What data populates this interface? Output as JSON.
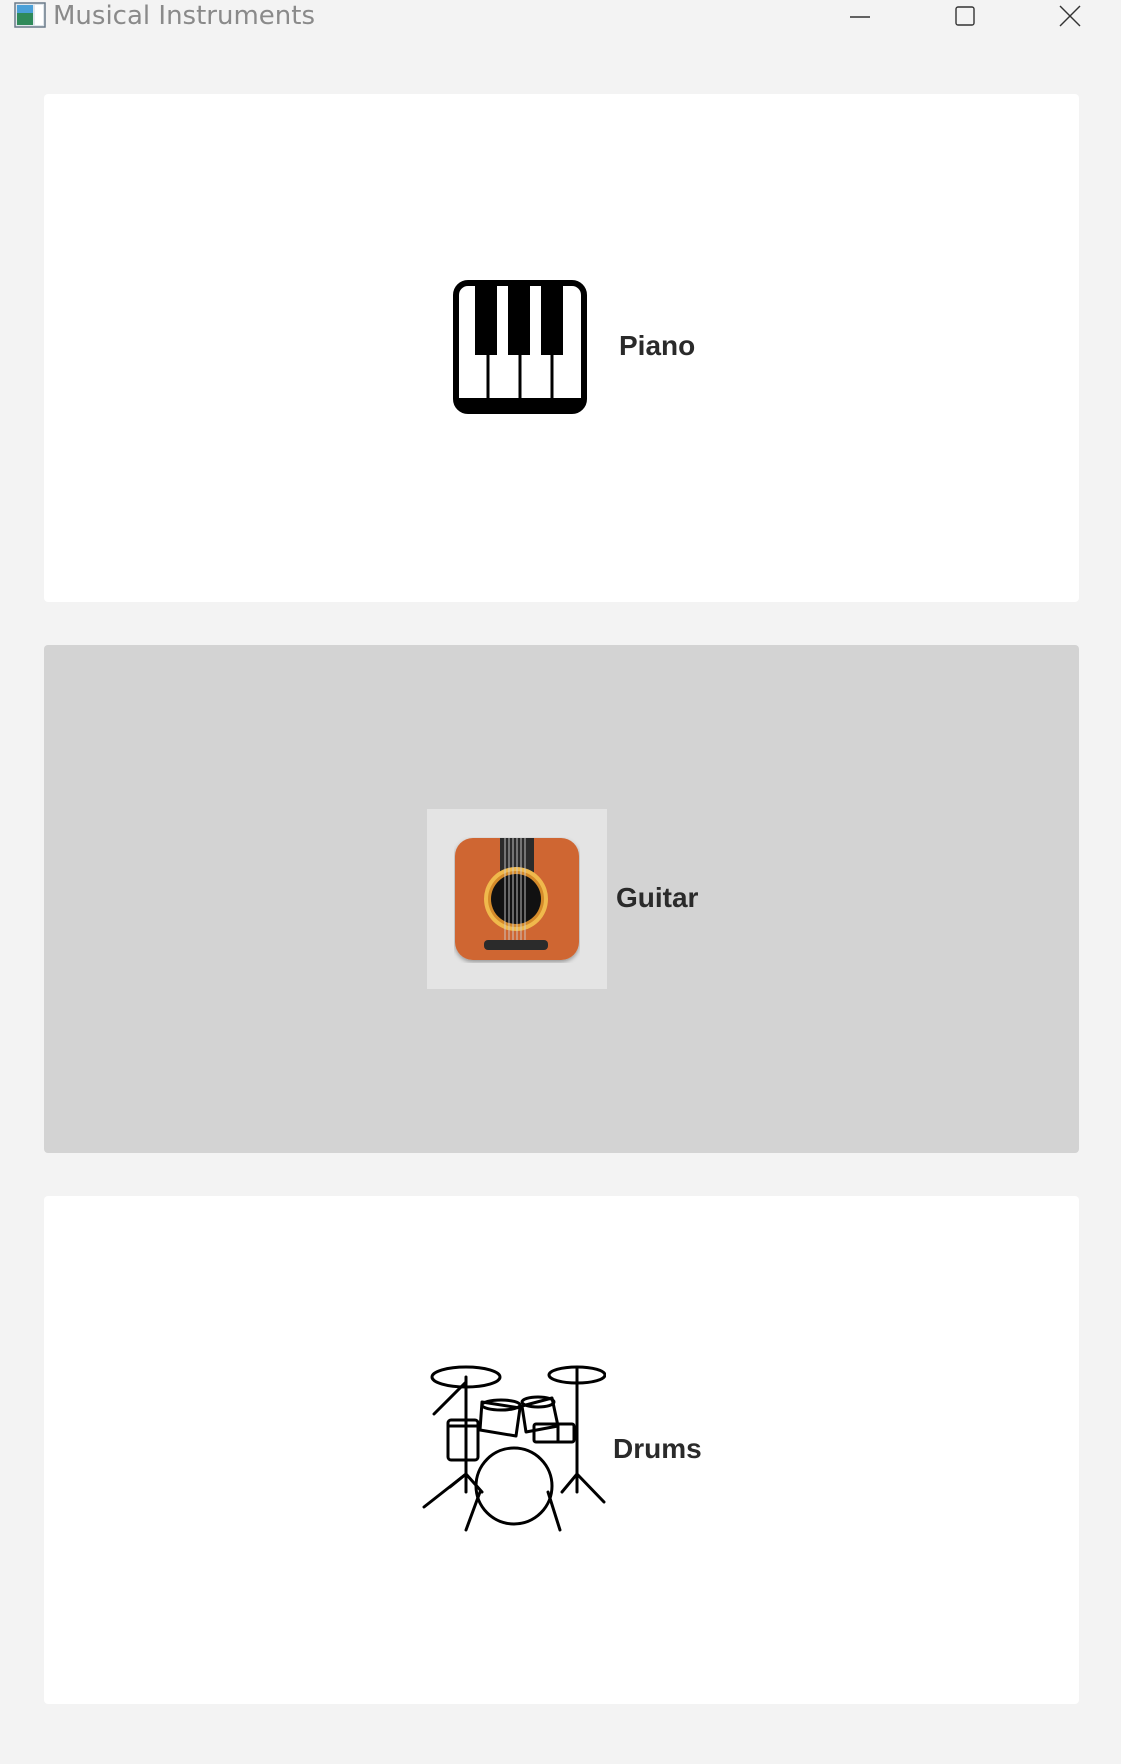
{
  "window": {
    "title": "Musical Instruments",
    "icons": [
      "app-icon",
      "minimize-icon",
      "maximize-icon",
      "close-icon"
    ]
  },
  "instruments": [
    {
      "label": "Piano",
      "icon": "piano-icon",
      "selected": false
    },
    {
      "label": "Guitar",
      "icon": "guitar-icon",
      "selected": true
    },
    {
      "label": "Drums",
      "icon": "drums-icon",
      "selected": false
    }
  ],
  "colors": {
    "window_bg": "#f3f3f3",
    "card_bg": "#ffffff",
    "card_selected_bg": "#d3d3d3",
    "guitar_body": "#cf6630",
    "guitar_ring": "#f0b94c"
  }
}
